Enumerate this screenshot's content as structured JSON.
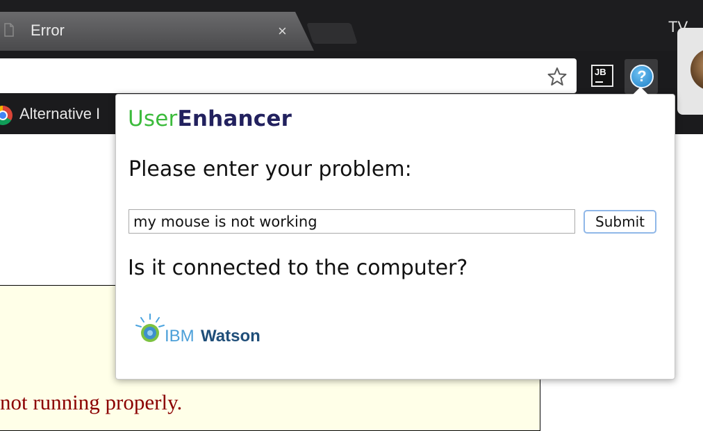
{
  "tab": {
    "title": "Error",
    "close_glyph": "×",
    "icon": "document-icon"
  },
  "profile": {
    "initials": "TV"
  },
  "toolbar": {
    "star_icon": "star-icon",
    "jb_label": "JB",
    "help_glyph": "?"
  },
  "bookmarks": {
    "items": [
      {
        "label": "Alternative I",
        "icon": "chrome-icon"
      }
    ]
  },
  "page": {
    "error_text": "not running properly."
  },
  "popup": {
    "brand_part1": "User",
    "brand_part2": "Enhancer",
    "prompt": "Please enter your problem:",
    "input_value": "my mouse is not working",
    "submit_label": "Submit",
    "answer": "Is it connected to the computer?",
    "logo_ibm": "IBM",
    "logo_watson": "Watson"
  },
  "colors": {
    "brand_green": "#3cbb3c",
    "brand_navy": "#22215e",
    "error_text": "#8b0000",
    "page_bg": "#ffffe8"
  }
}
